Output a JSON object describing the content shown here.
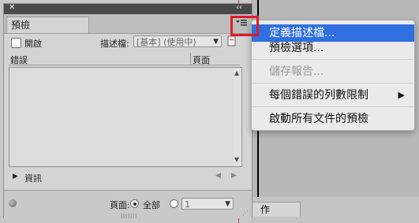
{
  "panel": {
    "tab_title": "預檢",
    "on_label": "開啟",
    "profile_label": "描述檔:",
    "profile_value": "[基本] (使用中)",
    "list_columns": [
      "錯誤",
      "頁面"
    ],
    "info_label": "資訊",
    "pages_label": "頁面:",
    "all_label": "全部",
    "page_range_value": "1"
  },
  "menu": {
    "items": [
      {
        "label": "定義描述檔...",
        "state": "selected"
      },
      {
        "label": "預檢選項...",
        "state": "normal"
      },
      {
        "label": "儲存報告...",
        "state": "disabled"
      },
      {
        "label": "每個錯誤的列數限制",
        "state": "normal",
        "submenu": true
      },
      {
        "label": "啟動所有文件的預檢",
        "state": "normal"
      }
    ]
  },
  "background": {
    "bottom_tab_label": "作"
  },
  "colors": {
    "selection": "#2f6fe0",
    "callout": "#e01b24",
    "titlebar": "#4a4a4a"
  }
}
